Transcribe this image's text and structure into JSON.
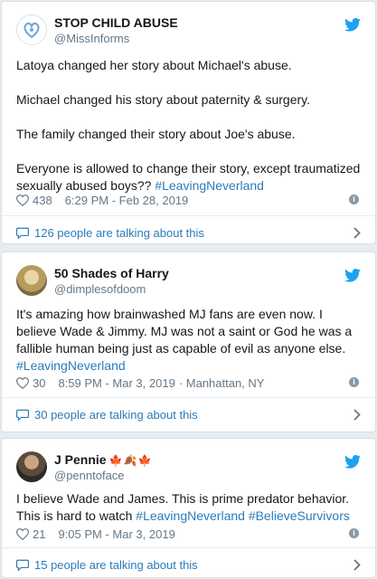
{
  "tweets": [
    {
      "display_name": "STOP CHILD ABUSE",
      "handle": "@MissInforms",
      "paragraphs": [
        "Latoya changed her story about Michael's abuse.",
        "Michael changed his story about paternity & surgery.",
        "The family changed their story about Joe's abuse."
      ],
      "last_text": "Everyone is allowed to change their story, except traumatized sexually abused boys?? ",
      "last_hashtag": "#LeavingNeverland",
      "likes": "438",
      "timestamp": "6:29 PM - Feb 28, 2019",
      "location": "",
      "talking": "126 people are talking about this"
    },
    {
      "display_name": "50 Shades of Harry",
      "handle": "@dimplesofdoom",
      "text": "It's amazing how brainwashed MJ fans are even now. I believe Wade & Jimmy. MJ was not a saint or God he was a fallible human being just as capable of evil as anyone else. ",
      "hashtag": "#LeavingNeverland",
      "likes": "30",
      "timestamp": "8:59 PM - Mar 3, 2019",
      "location": "· Manhattan, NY",
      "talking": "30 people are talking about this"
    },
    {
      "display_name": "J Pennie",
      "name_flags": "🍁🍂🍁",
      "handle": "@penntoface",
      "text": "I believe Wade and James. This is prime predator behavior. This is hard to watch ",
      "hashtag1": "#LeavingNeverland",
      "hashtag2": "#BelieveSurvivors",
      "likes": "21",
      "timestamp": "9:05 PM - Mar 3, 2019",
      "location": "",
      "talking": "15 people are talking about this"
    }
  ],
  "colors": {
    "accent": "#2b7bb9",
    "twitter_blue": "#1da1f2",
    "muted": "#657786",
    "background": "#e6ecf0"
  },
  "icons": [
    "twitter-bird-icon",
    "heart-icon",
    "info-icon",
    "speech-bubble-icon",
    "chevron-right-icon"
  ]
}
